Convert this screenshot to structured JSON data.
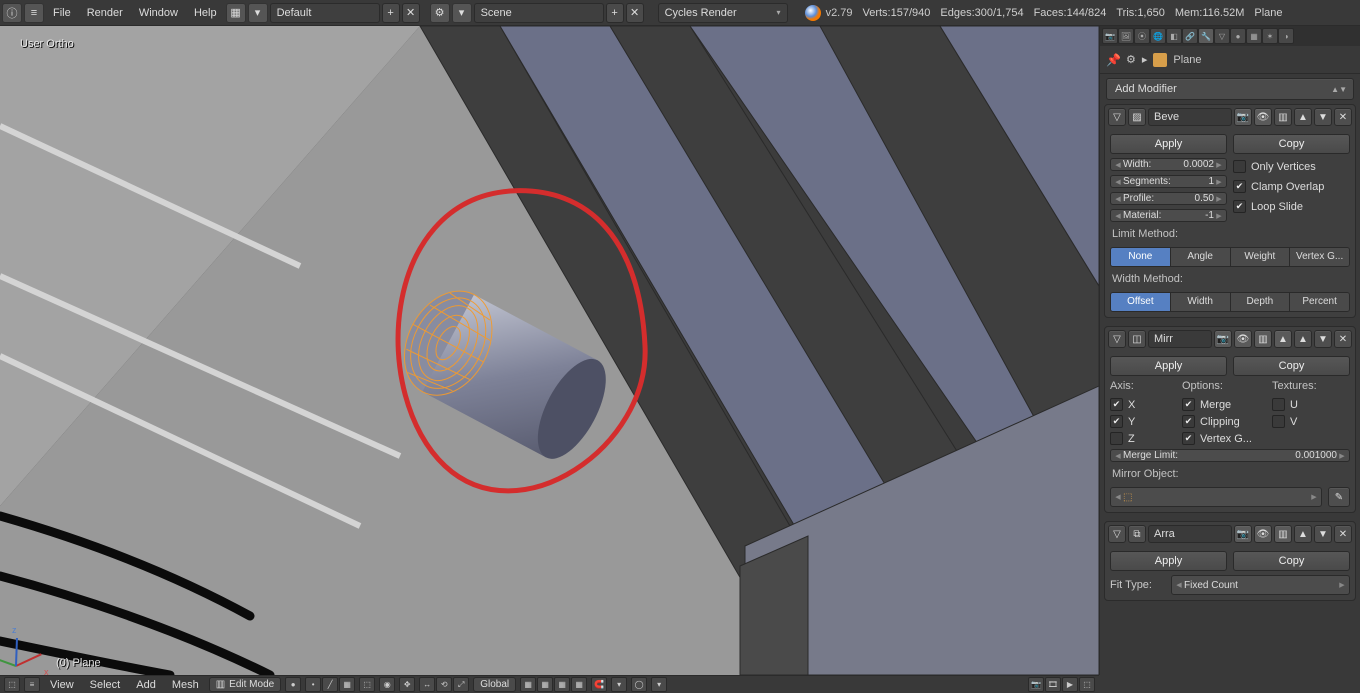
{
  "top": {
    "menus": [
      "File",
      "Render",
      "Window",
      "Help"
    ],
    "layout_selector": "Default",
    "scene_selector": "Scene",
    "engine_selector": "Cycles Render",
    "version": "v2.79",
    "stats": {
      "verts": "Verts:157/940",
      "edges": "Edges:300/1,754",
      "faces": "Faces:144/824",
      "tris": "Tris:1,650",
      "mem": "Mem:116.52M",
      "object": "Plane"
    }
  },
  "viewport": {
    "overlay_top": "User Ortho",
    "overlay_bottom": "(0) Plane"
  },
  "footer": {
    "menus": [
      "View",
      "Select",
      "Add",
      "Mesh"
    ],
    "mode": "Edit Mode",
    "orientation": "Global"
  },
  "panel": {
    "breadcrumb_obj": "Plane",
    "add_modifier": "Add Modifier",
    "bevel": {
      "name": "Beve",
      "apply": "Apply",
      "copy": "Copy",
      "width_label": "Width:",
      "width_val": "0.0002",
      "segments_label": "Segments:",
      "segments_val": "1",
      "profile_label": "Profile:",
      "profile_val": "0.50",
      "material_label": "Material:",
      "material_val": "-1",
      "only_vertices": "Only Vertices",
      "clamp_overlap": "Clamp Overlap",
      "loop_slide": "Loop Slide",
      "limit_method_label": "Limit Method:",
      "limit_options": [
        "None",
        "Angle",
        "Weight",
        "Vertex G..."
      ],
      "width_method_label": "Width Method:",
      "width_options": [
        "Offset",
        "Width",
        "Depth",
        "Percent"
      ]
    },
    "mirror": {
      "name": "Mirr",
      "apply": "Apply",
      "copy": "Copy",
      "axis_head": "Axis:",
      "options_head": "Options:",
      "textures_head": "Textures:",
      "x": "X",
      "y": "Y",
      "z": "Z",
      "merge": "Merge",
      "clipping": "Clipping",
      "vertexg": "Vertex G...",
      "u": "U",
      "v": "V",
      "merge_limit_label": "Merge Limit:",
      "merge_limit_val": "0.001000",
      "mirror_object_label": "Mirror Object:"
    },
    "array": {
      "name": "Arra",
      "apply": "Apply",
      "copy": "Copy",
      "fit_type_label": "Fit Type:",
      "fit_type_val": "Fixed Count"
    }
  }
}
